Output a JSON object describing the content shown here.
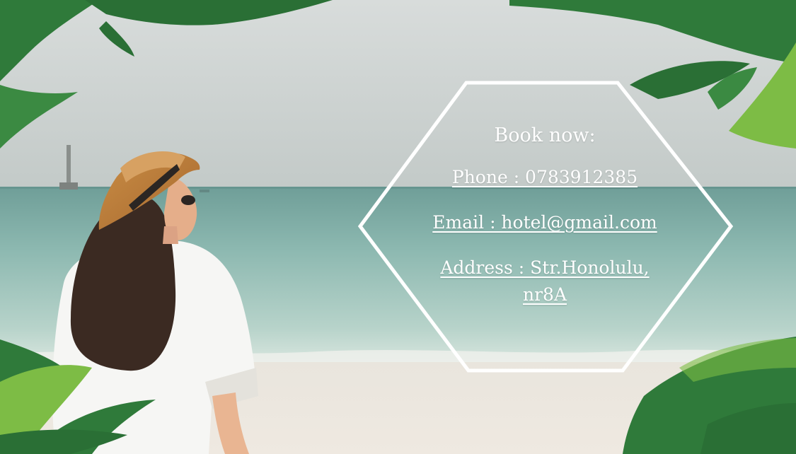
{
  "booking": {
    "title": "Book now:",
    "phone": "Phone : 0783912385",
    "email": "Email : hotel@gmail.com",
    "address": "Address : Str.Honolulu, nr8A"
  },
  "colors": {
    "sky_top": "#d5d9d8",
    "sky_horizon": "#c6ccca",
    "sea_far": "#79a8a1",
    "sea_near": "#bfd8d0",
    "sand": "#ece8e1",
    "palm_dark": "#2f7a3a",
    "palm_light": "#7dbc45",
    "hexagon_stroke": "#ffffff",
    "text": "#ffffff"
  },
  "icons": {
    "hexagon": "hexagon-frame-icon"
  }
}
